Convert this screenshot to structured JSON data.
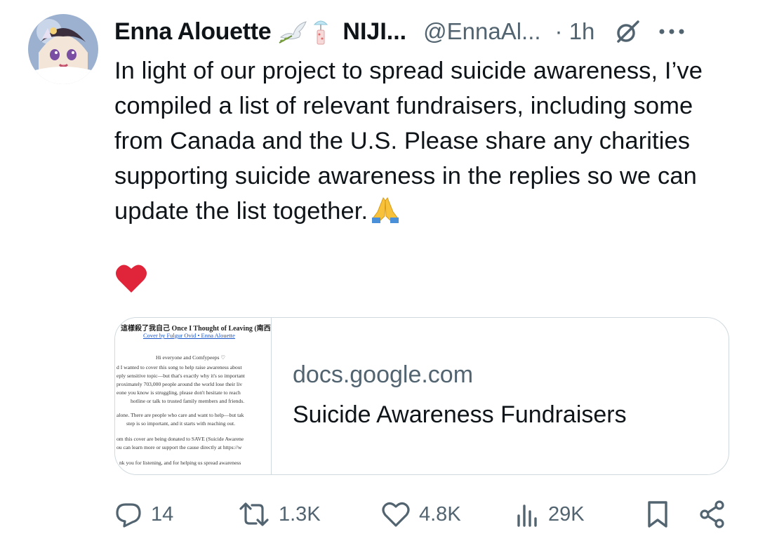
{
  "author": {
    "display_name": "Enna Alouette",
    "org": "NIJI...",
    "handle": "@EnnaAl...",
    "time": "· 1h",
    "badge_icons": [
      "dove-icon",
      "wind-chime-icon"
    ]
  },
  "tweet": {
    "text": "In light of our project to spread suicide awareness, I’ve compiled a list of relevant fundraisers, including some from Canada and the U.S. Please share any charities supporting suicide awareness in the replies so we can update the list together.",
    "trailing_emoji": "folded-hands-icon",
    "extra_emoji": "red-heart-icon"
  },
  "card": {
    "domain": "docs.google.com",
    "title": "Suicide Awareness Fundraisers",
    "thumb": {
      "title": "這樣殺了我自己 Once I Thought of Leaving (南西肖",
      "sub": "Cover by Fulgur Ovid • Enna Alouette",
      "lines": [
        "Hi everyone and Comfypeeps ♡",
        "d I wanted to cover this song to help raise awareness about",
        "eply sensitive topic—but that's exactly why it's so important",
        "proximately 703,000 people around the world lose their liv",
        "eone you know is struggling, please don't hesitate to reach",
        "hotline or talk to trusted family members and friends.",
        "alone. There are people who care and want to help—but tak",
        "step is so important, and it starts with reaching out.",
        "om this cover are being donated to SAVE (Suicide Awarene",
        "ou can learn more or support the cause directly at https://w",
        "nk you for listening, and for helping us spread awareness"
      ]
    }
  },
  "actions": {
    "replies": "14",
    "reposts": "1.3K",
    "likes": "4.8K",
    "views": "29K"
  },
  "colors": {
    "text": "#0f1419",
    "muted": "#536471",
    "border": "#cfd9de",
    "heart": "#e0243a"
  }
}
